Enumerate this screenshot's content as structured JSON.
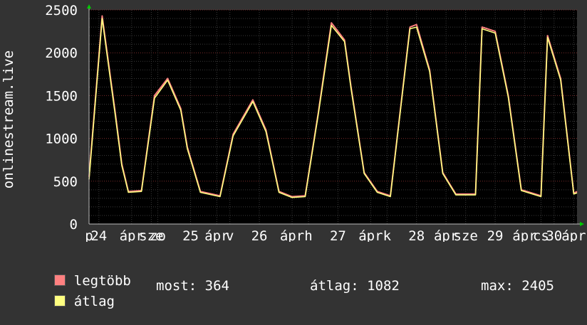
{
  "chart_data": {
    "type": "line",
    "ylabel": "onlinestream.live",
    "ylim": [
      0,
      2500
    ],
    "yticks": [
      0,
      500,
      1000,
      1500,
      2000,
      2500
    ],
    "ytick_labels": [
      "0",
      "500",
      "1000",
      "1500",
      "2000",
      "2500"
    ],
    "xlim": [
      0,
      7.45
    ],
    "xticks": [
      {
        "pos": 0,
        "label": "p"
      },
      {
        "pos": 0.15,
        "label": "24"
      },
      {
        "pos": 0.65,
        "label": "ápr"
      },
      {
        "pos": 0.95,
        "label": "sze"
      },
      {
        "pos": 1.05,
        "label": "zo"
      },
      {
        "pos": 1.55,
        "label": "25"
      },
      {
        "pos": 1.95,
        "label": "ápr"
      },
      {
        "pos": 2.15,
        "label": "v"
      },
      {
        "pos": 2.6,
        "label": "26"
      },
      {
        "pos": 3.1,
        "label": "ápr"
      },
      {
        "pos": 3.35,
        "label": "h"
      },
      {
        "pos": 3.8,
        "label": "27"
      },
      {
        "pos": 4.3,
        "label": "ápr"
      },
      {
        "pos": 4.55,
        "label": "k"
      },
      {
        "pos": 5.0,
        "label": "28"
      },
      {
        "pos": 5.45,
        "label": "ápr"
      },
      {
        "pos": 5.75,
        "label": "sze"
      },
      {
        "pos": 6.2,
        "label": "29"
      },
      {
        "pos": 6.65,
        "label": "ápr"
      },
      {
        "pos": 6.9,
        "label": "cs"
      },
      {
        "pos": 7.1,
        "label": "30"
      },
      {
        "pos": 7.4,
        "label": "ápr"
      }
    ],
    "grid": true,
    "series": [
      {
        "name": "legtöbb",
        "color": "#ff8080",
        "x": [
          0,
          0.2,
          0.4,
          0.5,
          0.6,
          0.8,
          1.0,
          1.2,
          1.4,
          1.5,
          1.7,
          2.0,
          2.2,
          2.5,
          2.7,
          2.9,
          3.1,
          3.3,
          3.5,
          3.7,
          3.9,
          4.0,
          4.2,
          4.4,
          4.6,
          4.9,
          5.0,
          5.2,
          5.4,
          5.6,
          5.9,
          6.0,
          6.2,
          6.4,
          6.6,
          6.9,
          7.0,
          7.2,
          7.4,
          7.45
        ],
        "y": [
          550,
          2430,
          1300,
          700,
          380,
          390,
          1500,
          1700,
          1350,
          900,
          380,
          330,
          1050,
          1450,
          1100,
          380,
          320,
          330,
          1300,
          2350,
          2150,
          1600,
          600,
          380,
          330,
          2300,
          2330,
          1800,
          600,
          350,
          350,
          2300,
          2250,
          1500,
          400,
          330,
          2200,
          1700,
          360,
          380
        ]
      },
      {
        "name": "átlag",
        "color": "#ffff80",
        "x": [
          0,
          0.2,
          0.4,
          0.5,
          0.6,
          0.8,
          1.0,
          1.2,
          1.4,
          1.5,
          1.7,
          2.0,
          2.2,
          2.5,
          2.7,
          2.9,
          3.1,
          3.3,
          3.5,
          3.7,
          3.9,
          4.0,
          4.2,
          4.4,
          4.6,
          4.9,
          5.0,
          5.2,
          5.4,
          5.6,
          5.9,
          6.0,
          6.2,
          6.4,
          6.6,
          6.9,
          7.0,
          7.2,
          7.4,
          7.45
        ],
        "y": [
          520,
          2400,
          1270,
          680,
          370,
          380,
          1470,
          1680,
          1330,
          880,
          370,
          320,
          1030,
          1430,
          1080,
          370,
          310,
          320,
          1280,
          2320,
          2130,
          1580,
          590,
          370,
          320,
          2280,
          2300,
          1780,
          590,
          340,
          340,
          2280,
          2230,
          1480,
          390,
          320,
          2180,
          1680,
          350,
          364
        ]
      }
    ]
  },
  "legend": {
    "max_label": "legtöbb",
    "avg_label": "átlag",
    "max_color": "#ff8080",
    "avg_color": "#ffff80"
  },
  "stats": {
    "current": "most: 364",
    "average": "átlag: 1082",
    "maximum": "max: 2405"
  }
}
